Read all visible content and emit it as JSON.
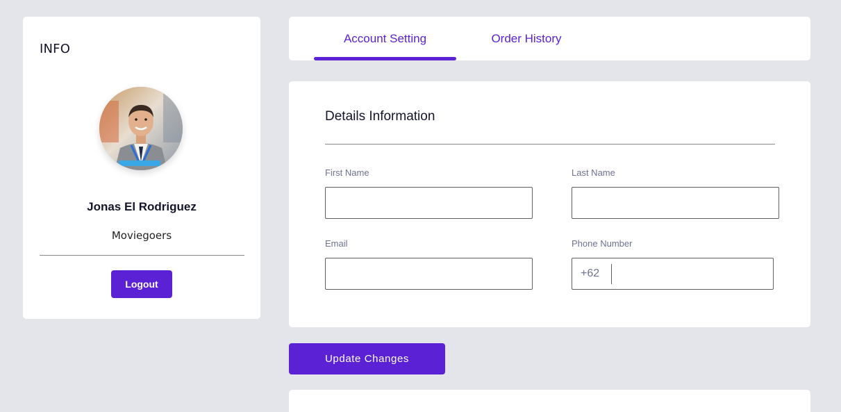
{
  "info": {
    "title": "INFO",
    "user_name": "Jonas El Rodriguez",
    "user_role": "Moviegoers",
    "logout_label": "Logout"
  },
  "tabs": [
    {
      "label": "Account Setting",
      "active": true
    },
    {
      "label": "Order History",
      "active": false
    }
  ],
  "details": {
    "title": "Details Information",
    "fields": {
      "first_name": {
        "label": "First Name",
        "value": ""
      },
      "last_name": {
        "label": "Last Name",
        "value": ""
      },
      "email": {
        "label": "Email",
        "value": ""
      },
      "phone": {
        "label": "Phone Number",
        "prefix": "+62",
        "value": ""
      }
    }
  },
  "update_label": "Update Changes",
  "colors": {
    "accent": "#5a22d4",
    "background": "#e4e5ea",
    "card": "#ffffff",
    "label_text": "#6e7191"
  }
}
